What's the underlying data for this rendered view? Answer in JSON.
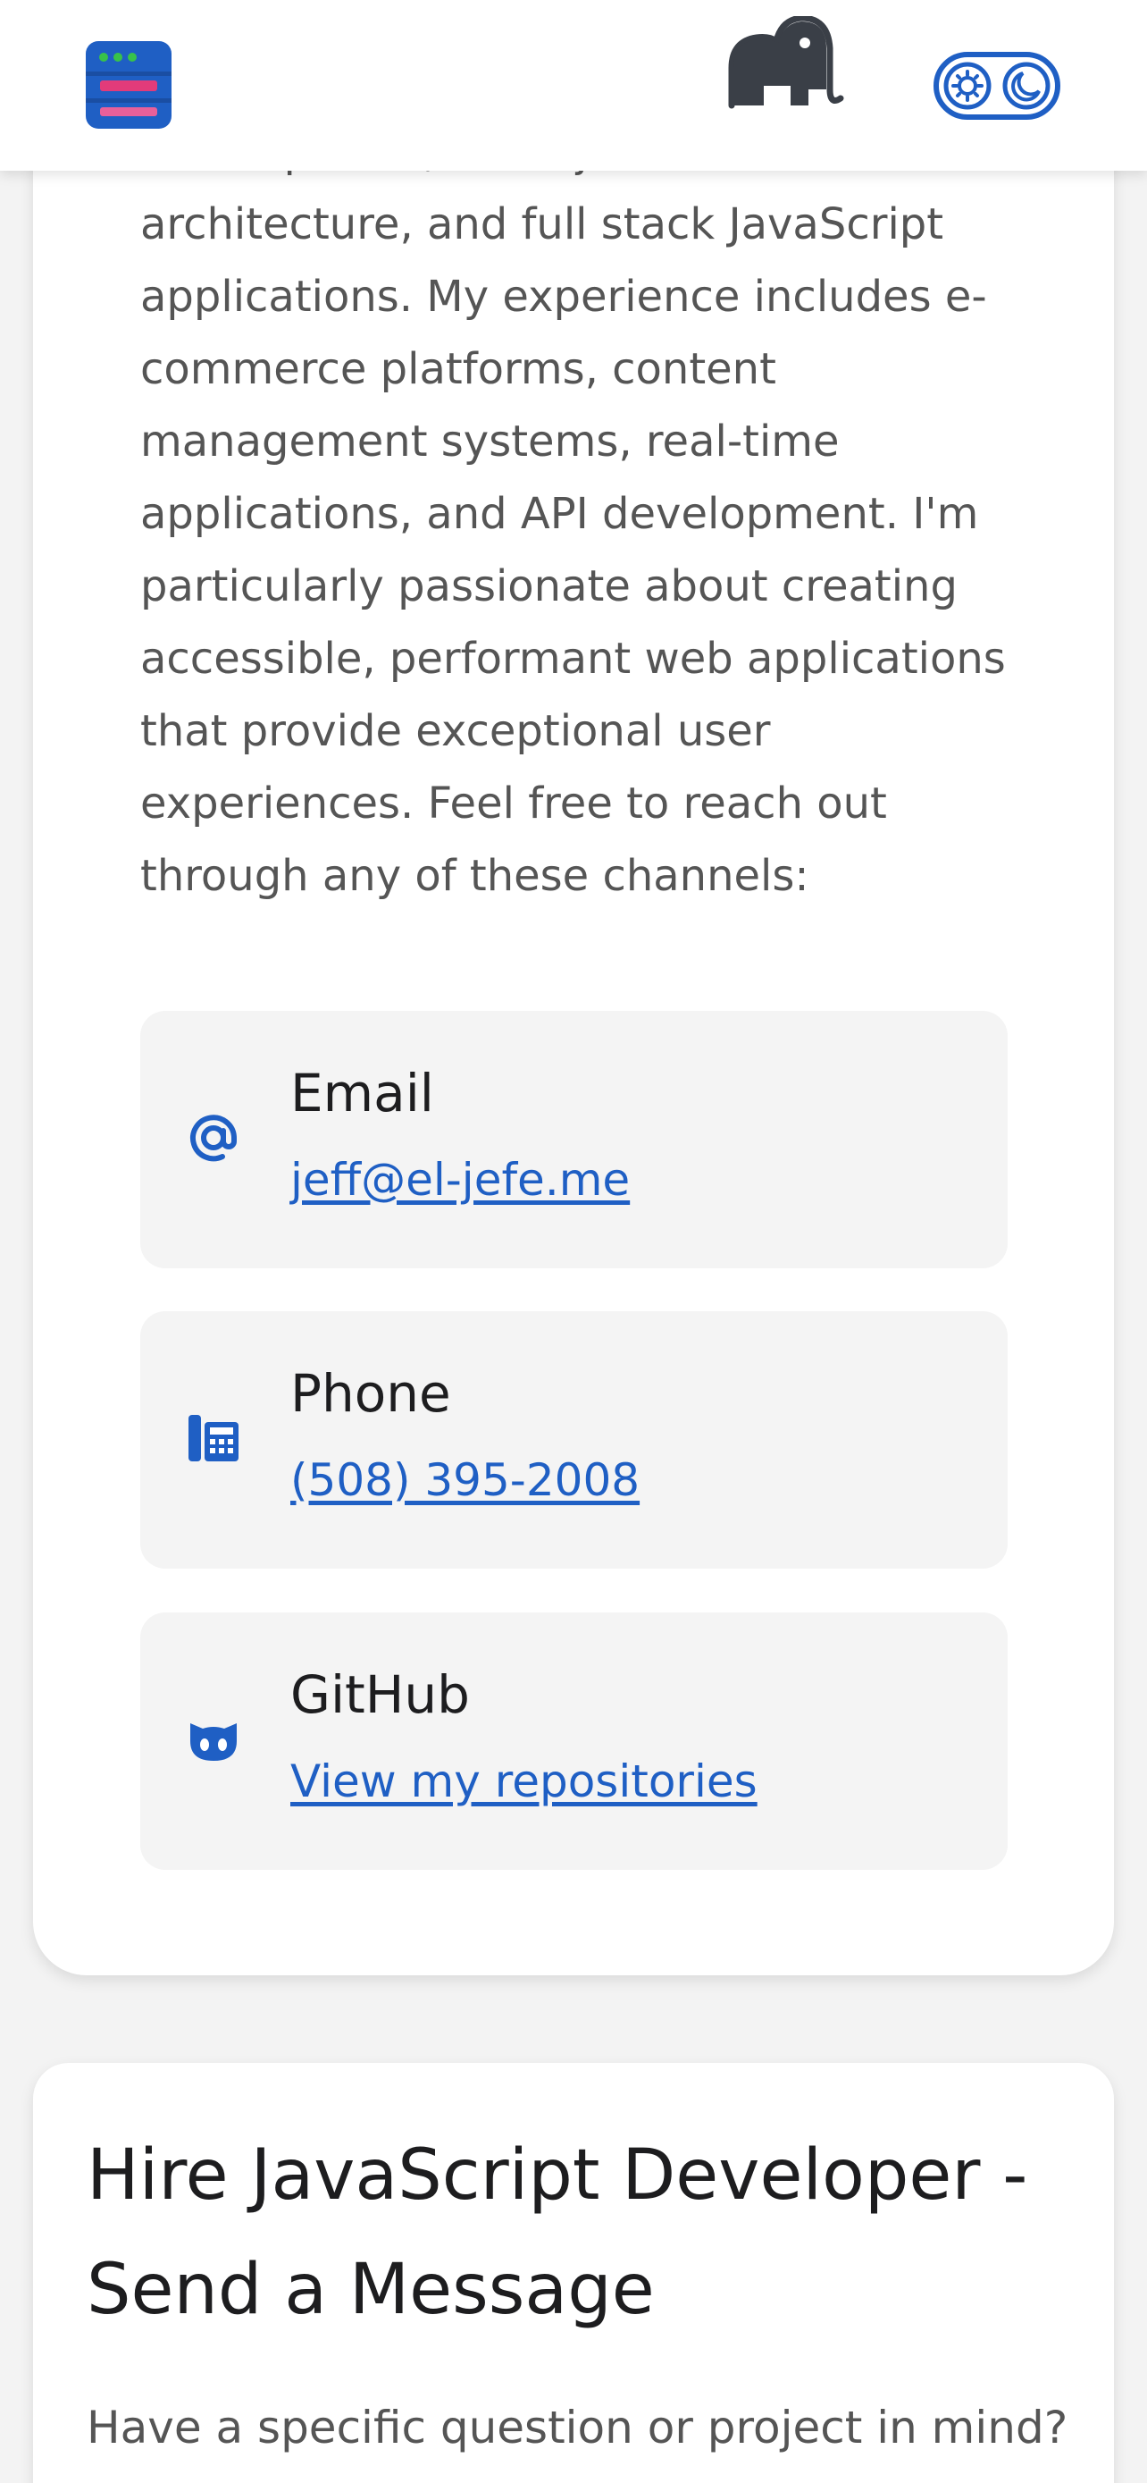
{
  "header": {
    "logo_icon": "stacked-server-logo-icon",
    "mascot_icon": "elephant-icon",
    "theme_toggle_icon": "sun-moon-toggle-icon"
  },
  "contact": {
    "intro_text": "development, Node.js backend architecture, and full stack JavaScript applications. My experience includes e-commerce platforms, content management systems, real-time applications, and API development. I'm particularly passionate about creating accessible, performant web applications that provide exceptional user experiences. Feel free to reach out through any of these channels:",
    "items": [
      {
        "icon": "at-sign-icon",
        "title": "Email",
        "link": "jeff@el-jefe.me"
      },
      {
        "icon": "phone-icon",
        "title": "Phone",
        "link": "(508) 395-2008"
      },
      {
        "icon": "github-icon",
        "title": "GitHub",
        "link": "View my repositories"
      }
    ]
  },
  "hire": {
    "title": "Hire JavaScript Developer - Send a Message",
    "description": "Have a specific question or project in mind? Drop me a message and I'll get back to"
  },
  "colors": {
    "accent": "#1f5fc4",
    "card_bg": "#ffffff",
    "item_bg": "#f4f4f4",
    "page_bg": "#f3f3f3"
  }
}
